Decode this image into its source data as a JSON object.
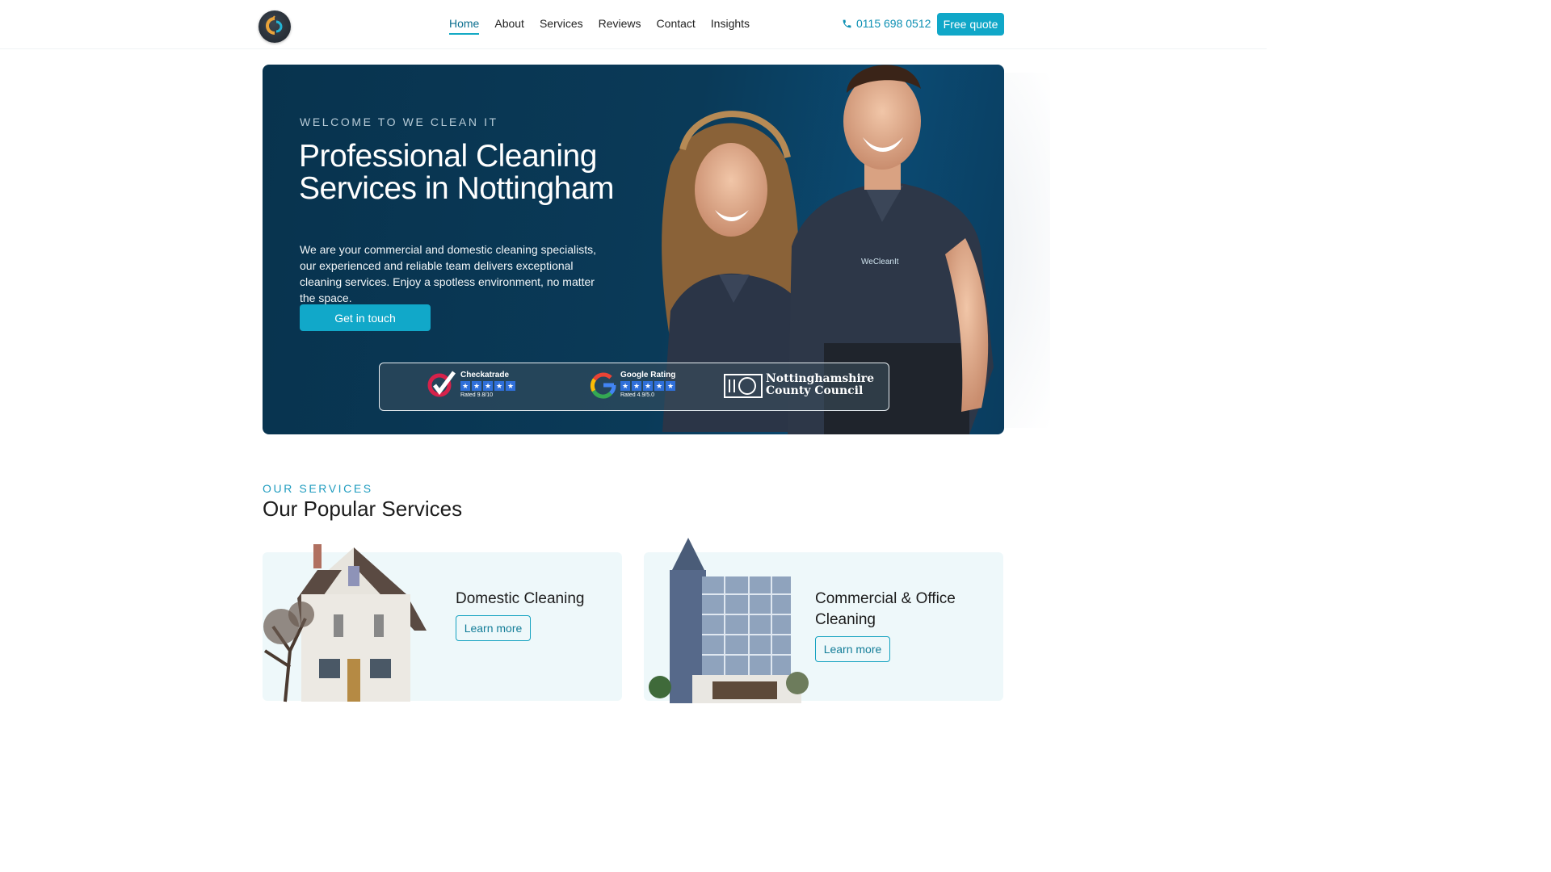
{
  "header": {
    "logo_alt": "We Clean It",
    "nav": [
      "Home",
      "About",
      "Services",
      "Reviews",
      "Contact",
      "Insights"
    ],
    "active_nav": "Home",
    "phone": "0115 698 0512",
    "quote_label": "Free quote"
  },
  "hero": {
    "eyebrow": "WELCOME TO WE CLEAN IT",
    "title": "Professional Cleaning Services in Nottingham",
    "description": "We are your commercial and domestic cleaning specialists, our experienced and reliable team delivers exceptional cleaning services. Enjoy a spotless environment, no matter the space.",
    "cta_label": "Get in touch",
    "shirt_logo": "WeCleanIt"
  },
  "ratings": {
    "checkatrade": {
      "name": "Checkatrade",
      "rated": "Rated 9.8/10",
      "stars": 5
    },
    "google": {
      "name": "Google Rating",
      "rated": "Rated 4.9/5.0",
      "stars": 5
    },
    "council": {
      "line1": "Nottinghamshire",
      "line2": "County Council"
    }
  },
  "services": {
    "eyebrow": "OUR SERVICES",
    "title": "Our Popular Services",
    "cards": [
      {
        "title": "Domestic Cleaning",
        "button": "Learn more"
      },
      {
        "title": "Commercial & Office Cleaning",
        "button": "Learn more"
      }
    ]
  },
  "colors": {
    "accent": "#10a7c8",
    "hero_bg": "#08334e",
    "card_bg": "#eef8fa"
  }
}
